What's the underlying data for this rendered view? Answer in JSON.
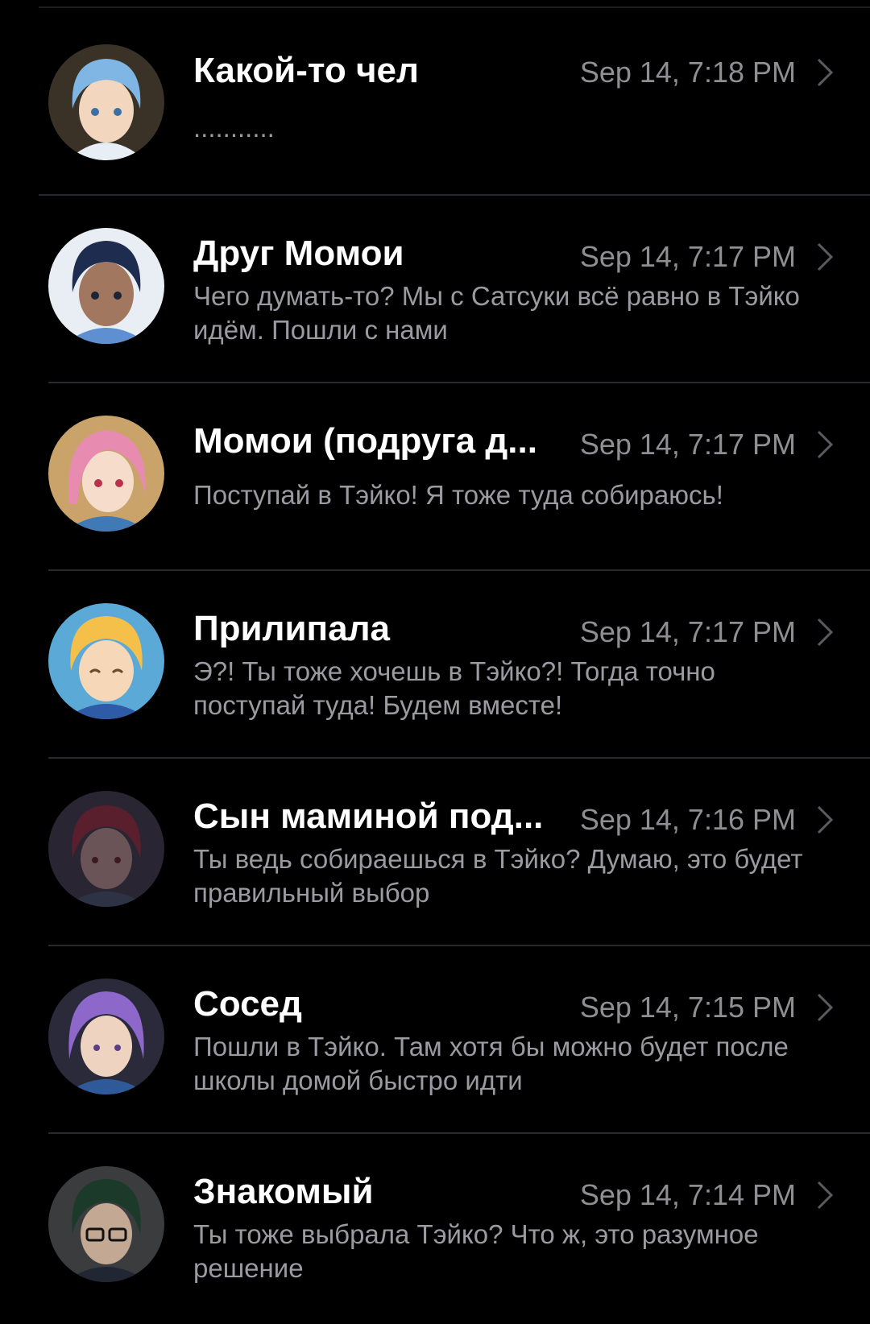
{
  "conversations": [
    {
      "name": "Какой-то чел",
      "time": "Sep 14, 7:18 PM",
      "preview": "...........",
      "avatar": "avatar-blue-hair",
      "avatar_colors": {
        "bg": "#3a3226",
        "hair": "#7fb6e3",
        "skin": "#f2d7be",
        "cloth": "#e8eef5"
      }
    },
    {
      "name": "Друг Момои",
      "time": "Sep 14, 7:17 PM",
      "preview": "Чего думать-то? Мы с Сатсуки всё равно в Тэйко идём. Пошли с нами",
      "avatar": "avatar-navy-hair",
      "avatar_colors": {
        "bg": "#e9eef4",
        "hair": "#1e2d4f",
        "skin": "#a27760",
        "cloth": "#5e8fd0"
      }
    },
    {
      "name": "Момои (подруга д...",
      "time": "Sep 14, 7:17 PM",
      "preview": "Поступай в Тэйко! Я тоже туда собираюсь!",
      "avatar": "avatar-pink-hair",
      "avatar_colors": {
        "bg": "#c9a36a",
        "hair": "#e88bb0",
        "skin": "#f5dccb",
        "cloth": "#3f79b6"
      }
    },
    {
      "name": "Прилипала",
      "time": "Sep 14, 7:17 PM",
      "preview": "Э?! Ты тоже хочешь в Тэйко?! Тогда точно поступай туда! Будем вместе!",
      "avatar": "avatar-blond-hair",
      "avatar_colors": {
        "bg": "#5aa9d6",
        "hair": "#f4c04a",
        "skin": "#f6d7b8",
        "cloth": "#2f5aa8"
      }
    },
    {
      "name": "Сын маминой под...",
      "time": "Sep 14, 7:16 PM",
      "preview": "Ты ведь собираешься в Тэйко? Думаю, это будет правильный выбор",
      "avatar": "avatar-red-hair",
      "avatar_colors": {
        "bg": "#2a2533",
        "hair": "#5a1f2c",
        "skin": "#6b5458",
        "cloth": "#2d3344"
      }
    },
    {
      "name": "Сосед",
      "time": "Sep 14, 7:15 PM",
      "preview": "Пошли в Тэйко. Там хотя бы можно будет после школы домой быстро идти",
      "avatar": "avatar-purple-hair",
      "avatar_colors": {
        "bg": "#2b2a3a",
        "hair": "#8d67c9",
        "skin": "#eed3c0",
        "cloth": "#2e5a9a"
      }
    },
    {
      "name": "Знакомый",
      "time": "Sep 14, 7:14 PM",
      "preview": "Ты тоже выбрала Тэйко? Что ж, это разумное решение",
      "avatar": "avatar-green-hair",
      "avatar_colors": {
        "bg": "#3a3c3e",
        "hair": "#1c3a2a",
        "skin": "#c3a894",
        "cloth": "#202733"
      }
    }
  ],
  "theme": {
    "background": "#000000",
    "name": "#ffffff",
    "secondary": "#8e8e93",
    "separator": "#2a2a2e"
  }
}
